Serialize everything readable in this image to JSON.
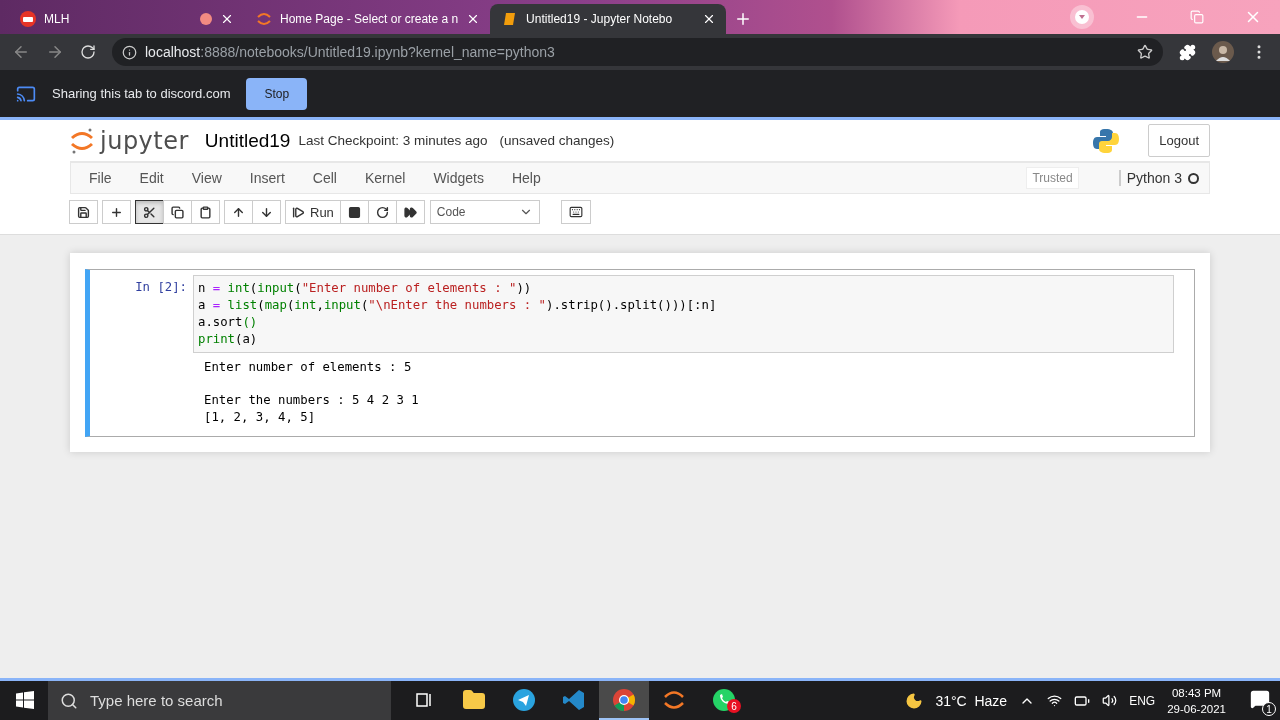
{
  "browser": {
    "tabs": [
      {
        "title": "MLH",
        "kind": "mlh",
        "recording": true,
        "selected": false
      },
      {
        "title": "Home Page - Select or create a n",
        "kind": "jupyter",
        "recording": false,
        "selected": false
      },
      {
        "title": "Untitled19 - Jupyter Notebo",
        "kind": "book",
        "recording": false,
        "selected": true
      }
    ],
    "url_host": "localhost",
    "url_rest": ":8888/notebooks/Untitled19.ipynb?kernel_name=python3"
  },
  "share_bar": {
    "message": "Sharing this tab to discord.com",
    "button": "Stop"
  },
  "notebook": {
    "logo": "jupyter",
    "name": "Untitled19",
    "checkpoint": "Last Checkpoint: 3 minutes ago",
    "unsaved": "(unsaved changes)",
    "logout": "Logout",
    "menu": [
      "File",
      "Edit",
      "View",
      "Insert",
      "Cell",
      "Kernel",
      "Widgets",
      "Help"
    ],
    "trusted": "Trusted",
    "kernel": "Python 3",
    "kernel_busy": false,
    "toolbar": [
      [
        {
          "kind": "save",
          "pressed": false
        }
      ],
      [
        {
          "kind": "add",
          "pressed": false
        }
      ],
      [
        {
          "kind": "cut",
          "pressed": true
        },
        {
          "kind": "copy",
          "pressed": false
        },
        {
          "kind": "paste",
          "pressed": false
        }
      ],
      [
        {
          "kind": "up",
          "pressed": false
        },
        {
          "kind": "down",
          "pressed": false
        }
      ],
      [
        {
          "kind": "run",
          "pressed": false,
          "label": "Run"
        },
        {
          "kind": "stop",
          "pressed": false
        },
        {
          "kind": "restart",
          "pressed": false
        },
        {
          "kind": "restart-run",
          "pressed": false
        }
      ]
    ],
    "cell_type": "Code",
    "cell": {
      "prompt": "In [2]:",
      "selected": true,
      "code": [
        [
          {
            "text": "n ",
            "kind": "plain"
          },
          {
            "text": "=",
            "kind": "op"
          },
          {
            "text": " int",
            "kind": "builtin"
          },
          {
            "text": "(",
            "kind": "plain"
          },
          {
            "text": "input",
            "kind": "builtin"
          },
          {
            "text": "(",
            "kind": "plain"
          },
          {
            "text": "\"Enter number of elements : \"",
            "kind": "string"
          },
          {
            "text": "))",
            "kind": "plain"
          }
        ],
        [
          {
            "text": "a ",
            "kind": "plain"
          },
          {
            "text": "=",
            "kind": "op"
          },
          {
            "text": " list",
            "kind": "builtin"
          },
          {
            "text": "(",
            "kind": "plain"
          },
          {
            "text": "map",
            "kind": "builtin"
          },
          {
            "text": "(",
            "kind": "plain"
          },
          {
            "text": "int",
            "kind": "builtin"
          },
          {
            "text": ",",
            "kind": "plain"
          },
          {
            "text": "input",
            "kind": "builtin"
          },
          {
            "text": "(",
            "kind": "plain"
          },
          {
            "text": "\"\\nEnter the numbers : \"",
            "kind": "string"
          },
          {
            "text": ").strip().split()))[:n]",
            "kind": "plain"
          }
        ],
        [
          {
            "text": "a.sort",
            "kind": "plain"
          },
          {
            "text": "()",
            "kind": "builtin"
          }
        ],
        [
          {
            "text": "print",
            "kind": "builtin"
          },
          {
            "text": "(a)",
            "kind": "plain"
          }
        ]
      ],
      "output": [
        [
          "Enter number of elements : 5"
        ],
        [
          "Enter the numbers : 5 4 2 3 1",
          "[1, 2, 3, 4, 5]"
        ]
      ]
    }
  },
  "taskbar": {
    "search_placeholder": "Type here to search",
    "apps": [
      {
        "kind": "taskview",
        "selected": false
      },
      {
        "kind": "folder",
        "selected": false
      },
      {
        "kind": "telegram",
        "selected": false
      },
      {
        "kind": "vscode",
        "selected": false
      },
      {
        "kind": "chrome",
        "selected": true
      },
      {
        "kind": "jupyter",
        "selected": false
      },
      {
        "kind": "whatsapp",
        "selected": false,
        "badge": "6"
      }
    ],
    "weather": "31°C  Haze",
    "language": "ENG",
    "time": "08:43 PM",
    "date": "29-06-2021",
    "notifications": "1"
  }
}
